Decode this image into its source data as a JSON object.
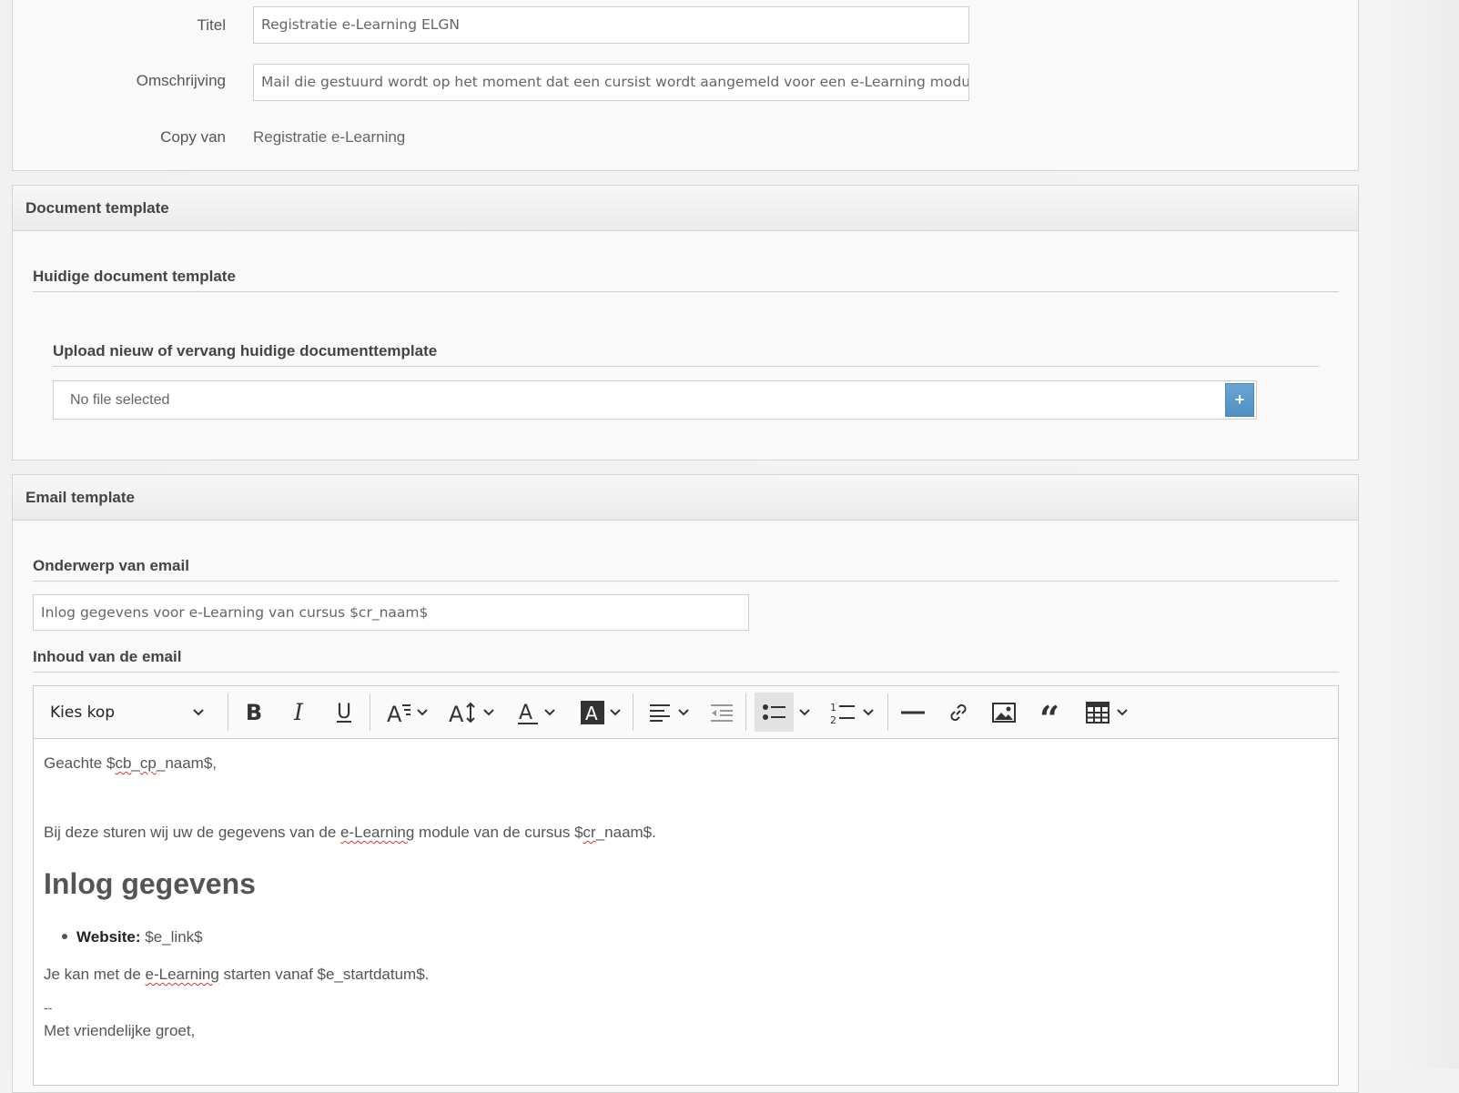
{
  "general": {
    "title_label": "Titel",
    "title_value": "Registratie e-Learning ELGN",
    "description_label": "Omschrijving",
    "description_value": "Mail die gestuurd wordt op het moment dat een cursist wordt aangemeld voor een e-Learning module",
    "copy_label": "Copy van",
    "copy_value": "Registratie e-Learning"
  },
  "document_template": {
    "heading": "Document template",
    "current_title": "Huidige document template",
    "upload_title": "Upload nieuw of vervang huidige documenttemplate",
    "file_status": "No file selected",
    "add_button": "+"
  },
  "email_template": {
    "heading": "Email template",
    "subject_title": "Onderwerp van email",
    "subject_value": "Inlog gegevens voor e-Learning van cursus $cr_naam$",
    "body_title": "Inhoud van de email",
    "toolbar": {
      "heading_select": "Kies kop",
      "icons": [
        "bold-icon",
        "italic-icon",
        "underline-icon",
        "font-family-icon",
        "font-size-icon",
        "font-color-icon",
        "font-background-icon",
        "align-left-icon",
        "outdent-icon",
        "bulleted-list-icon",
        "numbered-list-icon",
        "horizontal-line-icon",
        "link-icon",
        "image-icon",
        "blockquote-icon",
        "table-icon"
      ]
    },
    "body": {
      "greeting_prefix": "Geachte $",
      "greeting_spell1": "cb",
      "greeting_sep": "_",
      "greeting_spell2": "cp",
      "greeting_suffix": "_naam$,",
      "intro_prefix": "Bij deze sturen wij uw de gegevens van de ",
      "intro_spell": "e-Learning",
      "intro_mid": " module van de cursus $",
      "intro_spell2": "cr",
      "intro_suffix": "_naam$.",
      "heading": "Inlog gegevens",
      "list_label": "Website:",
      "list_value": " $e_link$",
      "start_prefix": "Je kan met de ",
      "start_spell": "e-Learning",
      "start_suffix": " starten vanaf $e_startdatum$.",
      "signature_dash": "--",
      "closing": "Met vriendelijke groet,"
    }
  },
  "colors": {
    "accent_button": "#5b9bd0",
    "spell_underline": "#dd3333"
  }
}
